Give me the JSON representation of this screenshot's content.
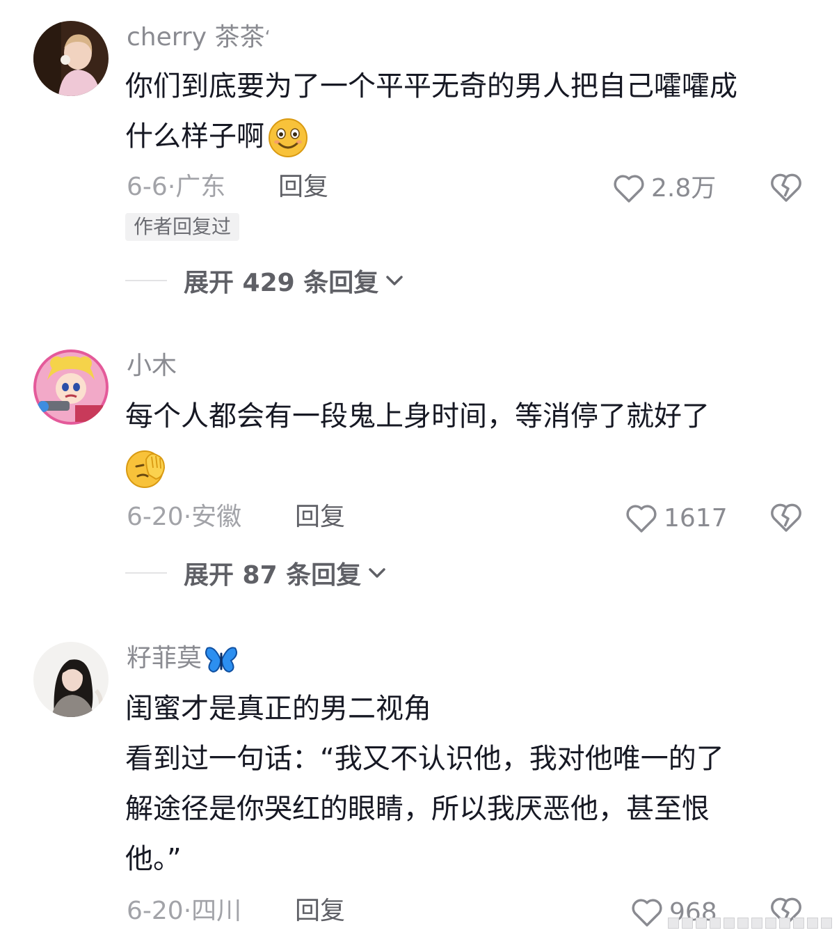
{
  "comments": [
    {
      "username": "cherry 茶茶",
      "username_suffix": "ʻ",
      "text_lines": [
        "你们到底要为了一个平平无奇的男人把自己嚯嚯成",
        "什么样子啊"
      ],
      "emoji": "smile-emoji",
      "date": "6-6",
      "location": "广东",
      "reply_label": "回复",
      "likes": "2.8万",
      "author_tag": "作者回复过",
      "expand_label": "展开 429 条回复"
    },
    {
      "username": "小木",
      "text_lines": [
        "每个人都会有一段鬼上身时间，等消停了就好了",
        ""
      ],
      "emoji": "facepalm-emoji",
      "date": "6-20",
      "location": "安徽",
      "reply_label": "回复",
      "likes": "1617",
      "expand_label": "展开 87 条回复"
    },
    {
      "username": "籽菲莫",
      "username_emoji": "butterfly-emoji",
      "text_lines": [
        "闺蜜才是真正的男二视角",
        "看到过一句话：“我又不认识他，我对他唯一的了",
        "解途径是你哭红的眼睛，所以我厌恶他，甚至恨",
        "他。”"
      ],
      "date": "6-20",
      "location": "四川",
      "reply_label": "回复",
      "likes": "968"
    }
  ],
  "separator": "·",
  "icons": {
    "like": "heart-outline-icon",
    "dislike": "broken-heart-icon",
    "expand": "chevron-down-icon"
  },
  "colors": {
    "text_primary": "#161823",
    "text_secondary": "#8a8b91",
    "tag_bg": "#f1f1f2"
  }
}
